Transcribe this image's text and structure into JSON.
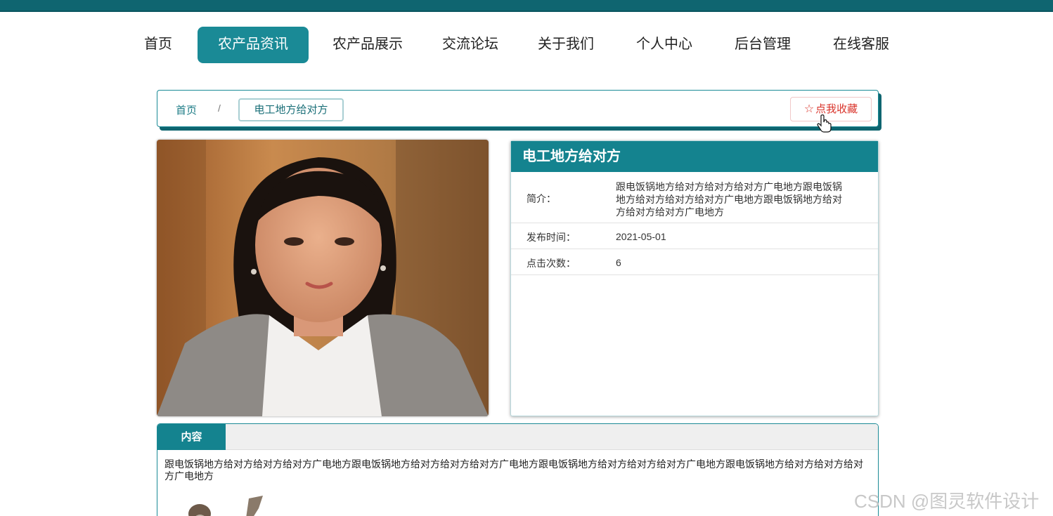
{
  "nav": {
    "items": [
      {
        "label": "首页",
        "active": false
      },
      {
        "label": "农产品资讯",
        "active": true
      },
      {
        "label": "农产品展示",
        "active": false
      },
      {
        "label": "交流论坛",
        "active": false
      },
      {
        "label": "关于我们",
        "active": false
      },
      {
        "label": "个人中心",
        "active": false
      },
      {
        "label": "后台管理",
        "active": false
      },
      {
        "label": "在线客服",
        "active": false
      }
    ]
  },
  "breadcrumb": {
    "home": "首页",
    "separator": "/",
    "current": "电工地方给对方"
  },
  "favorite": {
    "icon": "star-outline-icon",
    "label": "点我收藏"
  },
  "detail": {
    "title": "电工地方给对方",
    "intro_label": "简介：",
    "intro_value": "跟电饭锅地方给对方给对方给对方广电地方跟电饭锅地方给对方给对方给对方广电地方跟电饭锅地方给对方给对方给对方广电地方",
    "date_label": "发布时间：",
    "date_value": "2021-05-01",
    "clicks_label": "点击次数：",
    "clicks_value": "6"
  },
  "content": {
    "tab_label": "内容",
    "text": "跟电饭锅地方给对方给对方给对方广电地方跟电饭锅地方给对方给对方给对方广电地方跟电饭锅地方给对方给对方给对方广电地方跟电饭锅地方给对方给对方给对方广电地方"
  },
  "watermark": "CSDN @图灵软件设计",
  "colors": {
    "primary": "#14838f",
    "topbar": "#0f6570",
    "favorite": "#d9342b"
  }
}
